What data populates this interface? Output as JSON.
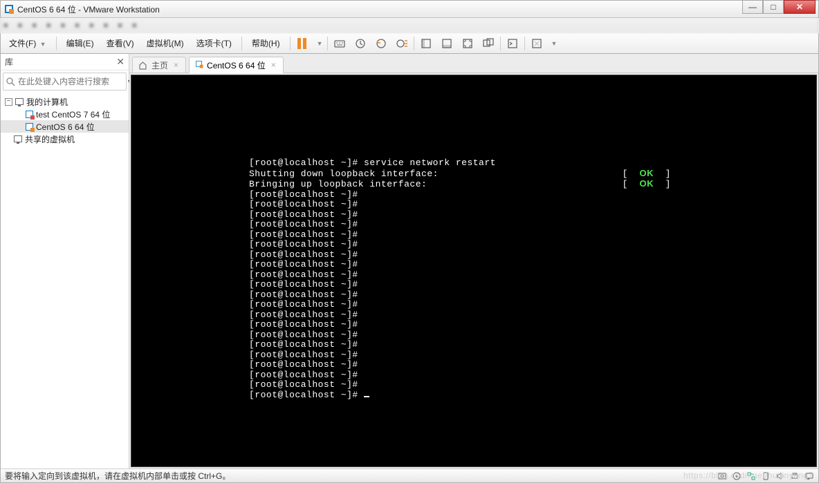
{
  "window": {
    "title": "CentOS 6 64 位 - VMware Workstation"
  },
  "menu": {
    "file": "文件(F)",
    "edit": "编辑(E)",
    "view": "查看(V)",
    "vm": "虚拟机(M)",
    "tabs": "选项卡(T)",
    "help": "帮助(H)"
  },
  "sidebar": {
    "title": "库",
    "search_placeholder": "在此处键入内容进行搜索",
    "tree": {
      "root": "我的计算机",
      "items": [
        {
          "label": "test CentOS 7 64 位"
        },
        {
          "label": "CentOS 6 64 位"
        }
      ],
      "shared": "共享的虚拟机"
    }
  },
  "tabs": {
    "home": "主页",
    "vm": "CentOS 6 64 位"
  },
  "terminal": {
    "cmd_line": "[root@localhost ~]# service network restart",
    "line2a": "Shutting down loopback interface:",
    "line3a": "Bringing up loopback interface:",
    "bracket_l": "[",
    "ok": "OK",
    "bracket_r": "]",
    "prompt": "[root@localhost ~]# ",
    "repeat_count": 20
  },
  "status": {
    "text": "要将输入定向到该虚拟机，请在虚拟机内部单击或按 Ctrl+G。"
  },
  "watermark": "https://blog.csdn.net/huijinyang7"
}
